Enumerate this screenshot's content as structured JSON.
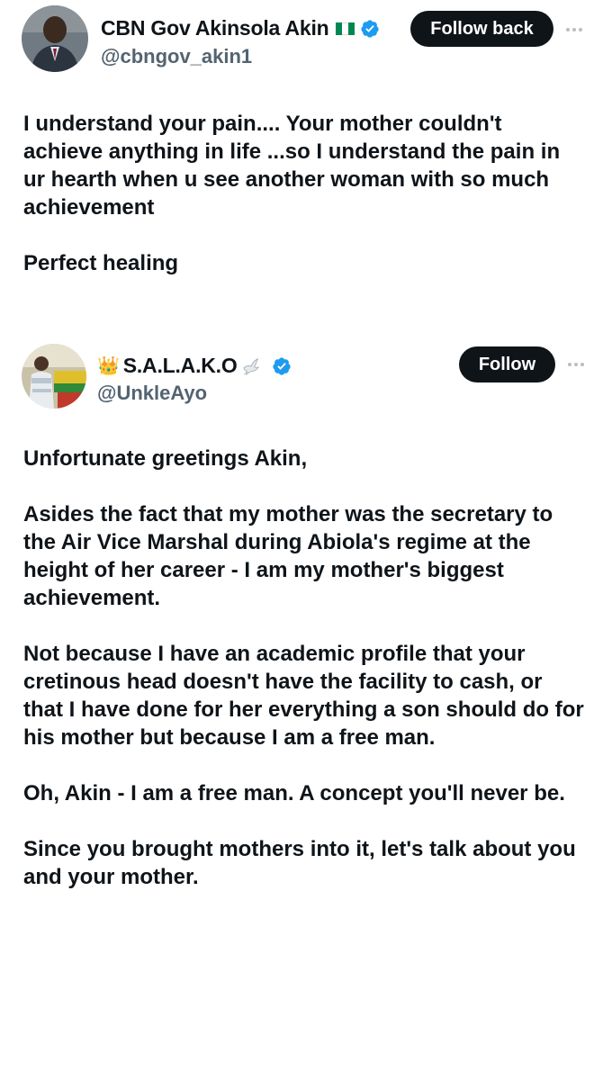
{
  "tweets": [
    {
      "author": {
        "name": "CBN Gov Akinsola Akin",
        "flag": "nigeria-flag",
        "verified": true,
        "handle": "@cbngov_akin1"
      },
      "follow_button": "Follow back",
      "more_icon": "more-horizontal-icon",
      "paragraphs": [
        "I understand your pain.... Your mother couldn't achieve anything in life ...so I understand the pain in ur hearth when u see another woman with so much achievement",
        "Perfect healing"
      ]
    },
    {
      "author": {
        "name": "S.A.L.A.K.O",
        "prefix_icon": "crown-icon",
        "suffix_icon": "dove-icon",
        "verified": true,
        "handle": "@UnkleAyo"
      },
      "follow_button": "Follow",
      "more_icon": "more-horizontal-icon",
      "paragraphs": [
        "Unfortunate greetings Akin,",
        "Asides the fact that my mother was the secretary to the Air Vice Marshal during Abiola's regime at the height of her career - I am my mother's biggest achievement.",
        "Not because I have an academic profile that your cretinous head doesn't have the facility to cash, or that I have done for her everything a son should do for his mother but because I am a free man.",
        "Oh, Akin - I am a free man. A concept you'll never be.",
        "Since you brought mothers into it, let's talk about you and your mother."
      ]
    }
  ],
  "colors": {
    "text": "#0f1419",
    "handle": "#536471",
    "button_bg": "#0f1419",
    "button_text": "#ffffff",
    "verified": "#1d9bf0",
    "flag_green": "#008751"
  }
}
